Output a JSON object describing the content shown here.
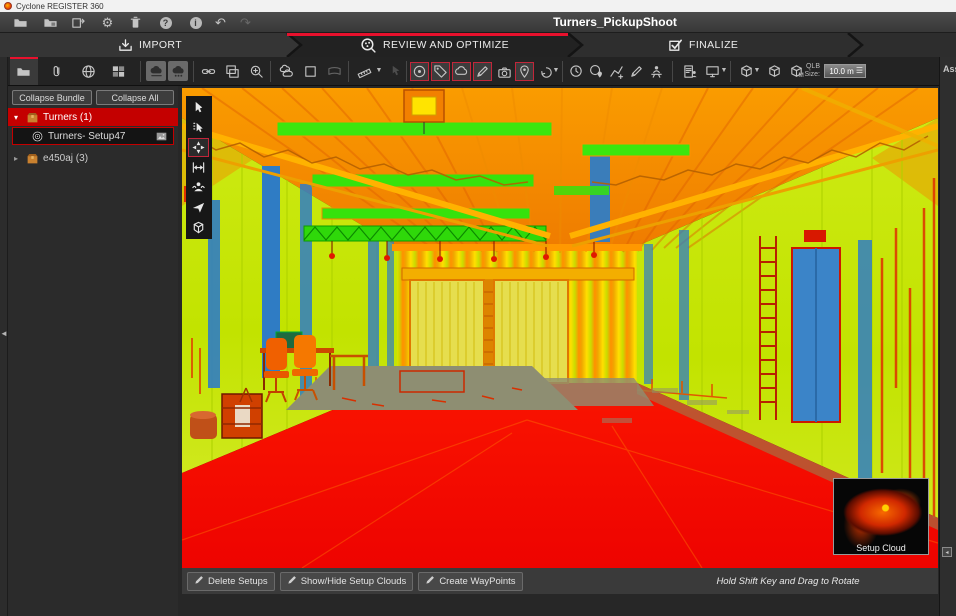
{
  "window": {
    "title": "Cyclone REGISTER 360"
  },
  "menubar": {
    "project_title": "Turners_PickupShoot",
    "icons": [
      "open-project",
      "import-project",
      "export",
      "settings-gear",
      "storage",
      "help",
      "info",
      "undo",
      "redo"
    ]
  },
  "workflow": {
    "steps": [
      {
        "label": "IMPORT",
        "icon": "import-tray-icon",
        "active": false
      },
      {
        "label": "REVIEW AND OPTIMIZE",
        "icon": "review-magnifier-icon",
        "active": true
      },
      {
        "label": "FINALIZE",
        "icon": "finalize-checkbox-icon",
        "active": false
      }
    ],
    "active_underline_color": "#e8112d"
  },
  "ribbon": {
    "tab_icons": [
      "project-folder",
      "paperclip-links",
      "globe-sites",
      "thumbnail-collage"
    ],
    "view_toggles": [
      "setup-cloud-view-1",
      "setup-cloud-view-2"
    ],
    "tool_icons": [
      "link",
      "overlap-windows",
      "zoom-region",
      "cloud-pair",
      "square-select",
      "panorama",
      "measure-ruler",
      "cursor-pin",
      "target",
      "tag-annotation",
      "cloud-annotation",
      "pen-markup",
      "camera-snapshot",
      "location-pin",
      "swirl-cloud-run",
      "globe-clock",
      "globe-pin",
      "polyline-add",
      "pen-draw",
      "person-setup",
      "report-person",
      "screen-display",
      "cube-view-dropdown",
      "cube-box",
      "cube-m"
    ],
    "qlb": {
      "label_line1": "QLB",
      "label_line2": "Size:",
      "value": "10.0 m"
    }
  },
  "assets_panel": {
    "label": "Assets"
  },
  "sidebar": {
    "buttons": [
      {
        "label": "Collapse Bundle"
      },
      {
        "label": "Collapse All"
      }
    ],
    "tree": [
      {
        "label": "Turners (1)",
        "type": "bundle",
        "expanded": true,
        "selected": true
      },
      {
        "label": "Turners- Setup47",
        "type": "setup",
        "selected": true,
        "badge": "image-thumbnail"
      },
      {
        "label": "e450aj (3)",
        "type": "bundle",
        "expanded": false
      }
    ]
  },
  "viewport": {
    "tool_palette": [
      "select-cursor",
      "select-area",
      "orbit-pan",
      "measure-distance",
      "panoramic-view",
      "fly-navigate",
      "cube-view"
    ],
    "active_tool": "orbit-pan",
    "thumbnail_label": "Setup Cloud",
    "hint": "Hold Shift Key and Drag to Rotate"
  },
  "bottombar": {
    "buttons": [
      {
        "label": "Delete Setups"
      },
      {
        "label": "Show/Hide Setup Clouds"
      },
      {
        "label": "Create WayPoints"
      }
    ]
  },
  "colors": {
    "accent_red": "#e8112d",
    "selection_red": "#c40000",
    "floor_red": "#f40c00",
    "wall_green": "#c6e31a",
    "ceiling_orange": "#f59300",
    "column_blue": "#2f7cc4"
  }
}
